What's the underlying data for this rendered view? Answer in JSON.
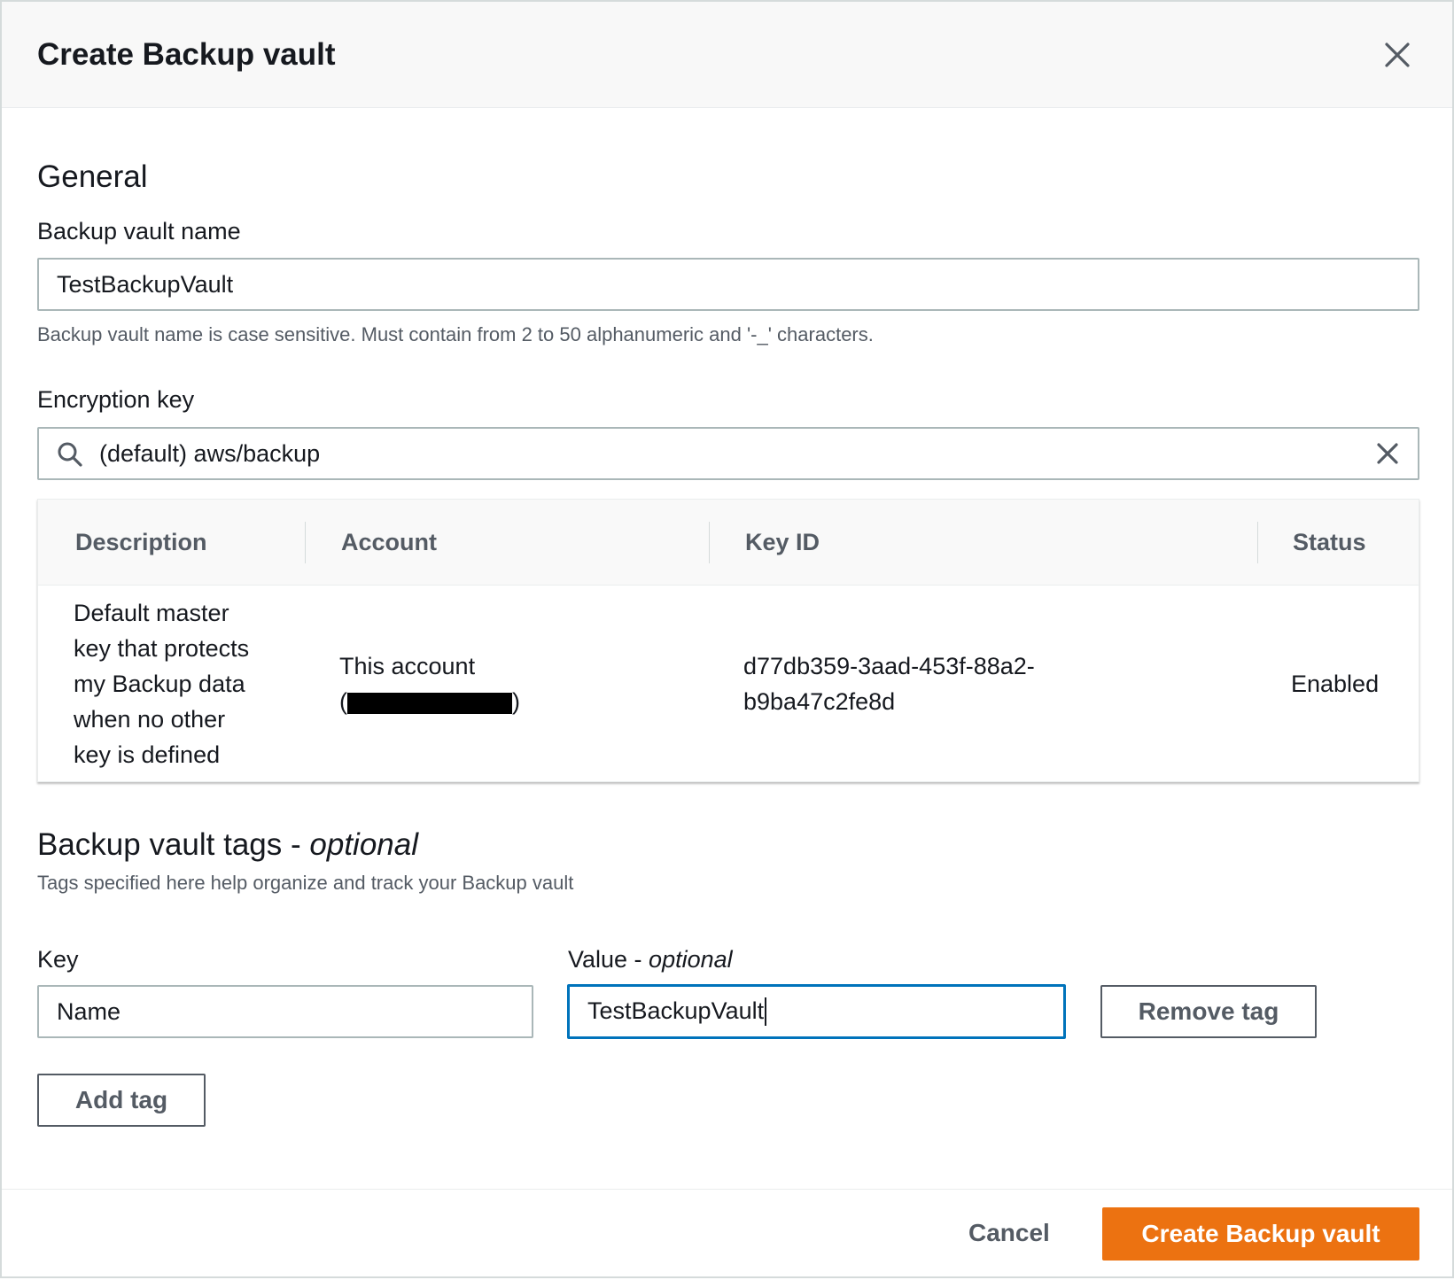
{
  "modal": {
    "title": "Create Backup vault",
    "close_icon": "close-icon"
  },
  "general": {
    "title": "General",
    "vault_name_label": "Backup vault name",
    "vault_name_value": "TestBackupVault",
    "vault_name_hint": "Backup vault name is case sensitive. Must contain from 2 to 50 alphanumeric and '-_' characters.",
    "encryption_label": "Encryption key",
    "encryption_value": "(default) aws/backup",
    "search_icon": "search-icon",
    "clear_icon": "clear-icon"
  },
  "key_table": {
    "columns": [
      "Description",
      "Account",
      "Key ID",
      "Status"
    ],
    "row": {
      "description_lines": [
        "Default master",
        "key that protects",
        "my Backup data",
        "when no other",
        "key is defined"
      ],
      "account_line1": "This account",
      "account_open": "(",
      "account_close": ")",
      "key_id_line1": "d77db359-3aad-453f-88a2-",
      "key_id_line2": "b9ba47c2fe8d",
      "status": "Enabled"
    }
  },
  "tags": {
    "title": "Backup vault tags - ",
    "title_optional": "optional",
    "hint": "Tags specified here help organize and track your Backup vault",
    "key_label": "Key",
    "value_label": "Value  - ",
    "value_label_optional": "optional",
    "key_value": "Name",
    "value_value": "TestBackupVault",
    "remove_tag": "Remove tag",
    "add_tag": "Add tag"
  },
  "footer": {
    "cancel": "Cancel",
    "create": "Create Backup vault"
  },
  "colors": {
    "primary_button": "#ec7211",
    "focus_border": "#0073bb",
    "header_bg": "#f8f8f8"
  }
}
